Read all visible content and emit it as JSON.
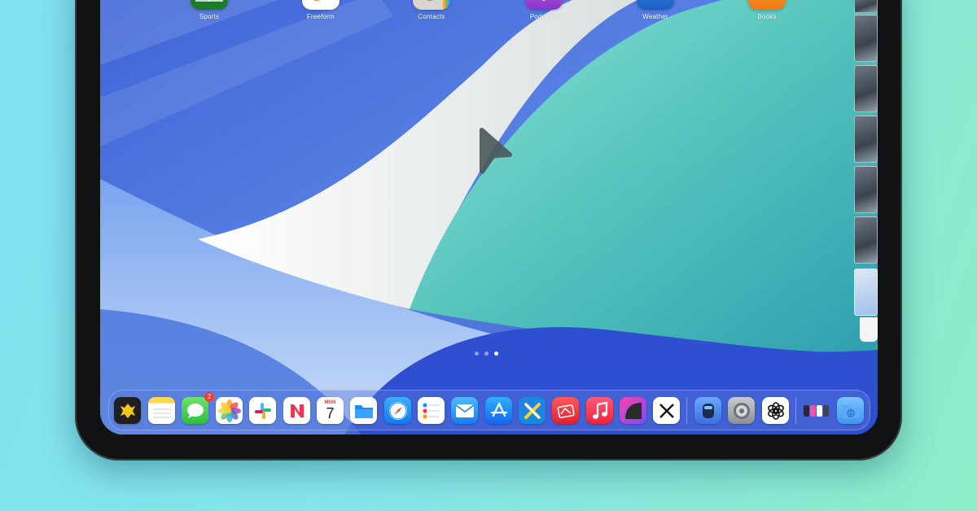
{
  "home_apps": [
    {
      "label": "Sports",
      "icon": "sports-icon"
    },
    {
      "label": "Freeform",
      "icon": "freeform-icon"
    },
    {
      "label": "Contacts",
      "icon": "contacts-icon"
    },
    {
      "label": "Podcasts",
      "icon": "podcasts-icon"
    },
    {
      "label": "Weather",
      "icon": "weather-icon"
    },
    {
      "label": "Books",
      "icon": "books-icon"
    }
  ],
  "dock": {
    "messages_badge": "2",
    "calendar_weekday": "MON",
    "calendar_day": "7",
    "apps": [
      "tes-app-icon",
      "notes-icon",
      "messages-icon",
      "photos-icon",
      "slack-icon",
      "news-icon",
      "calendar-icon",
      "files-icon",
      "safari-icon",
      "reminders-icon",
      "mail-icon",
      "app-store-icon",
      "xcode-toolbox-icon",
      "pixelmator-icon",
      "music-icon",
      "arc-icon",
      "x-icon",
      "reality-icon",
      "settings-icon",
      "chatgpt-icon",
      "recent-apps-icon",
      "downloads-folder-icon"
    ]
  },
  "page_indicator": {
    "pages": 3,
    "active": 3
  },
  "colors": {
    "wallpaper_blue": "#2e57c9",
    "wallpaper_teal": "#4fc7bf",
    "wallpaper_cream": "#f1efe4",
    "background_left": "#7fe0f0",
    "background_right": "#8eecc8"
  }
}
